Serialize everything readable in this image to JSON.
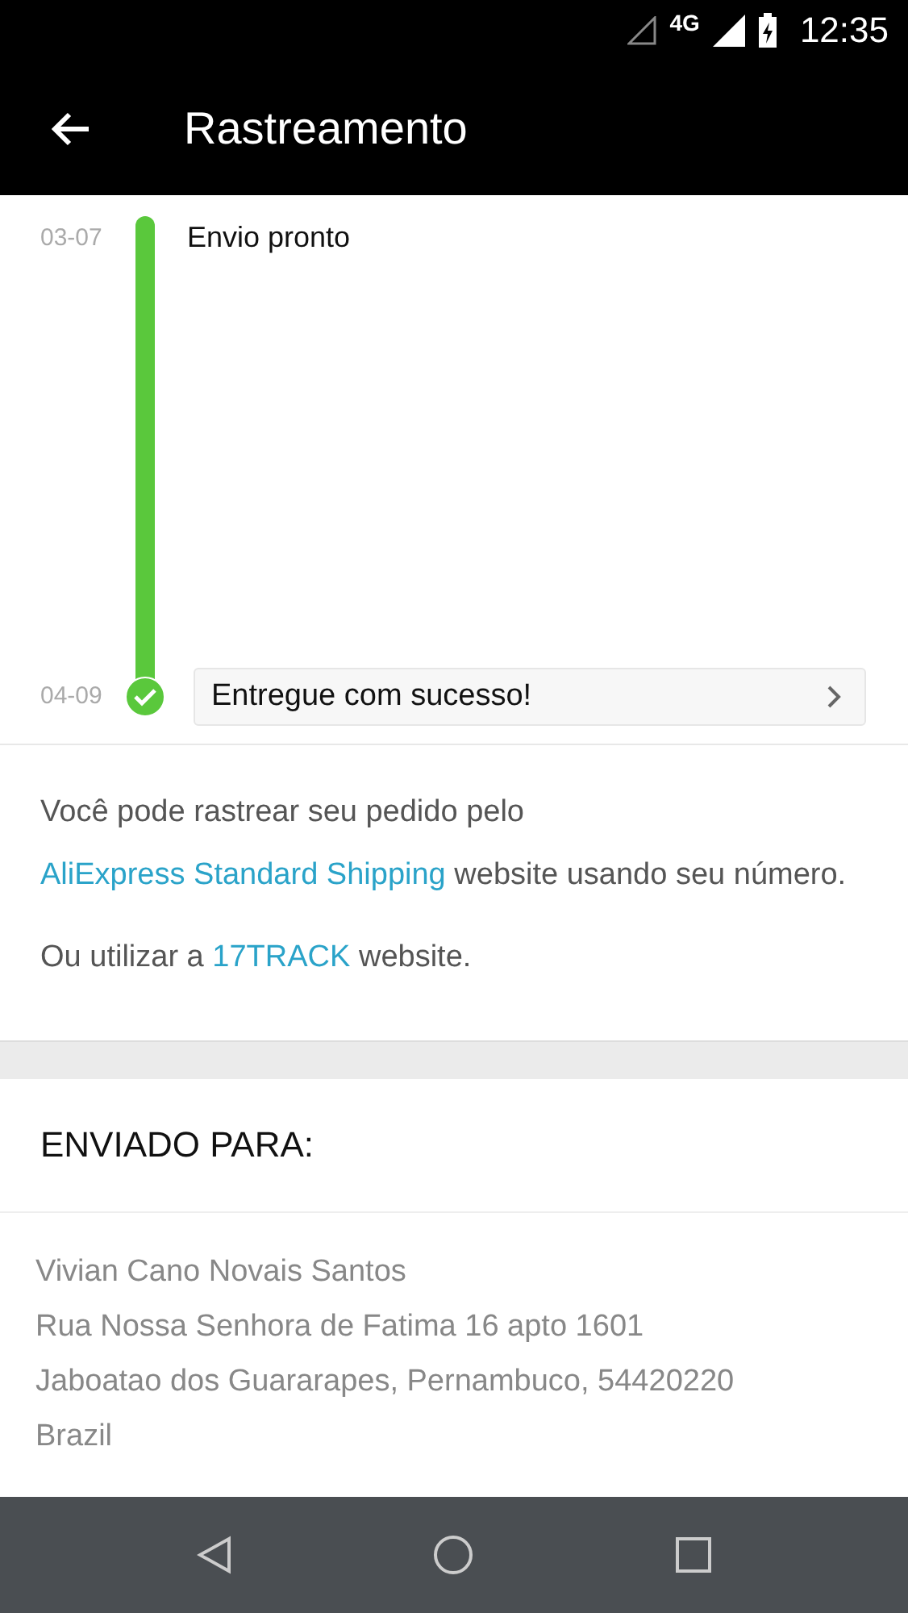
{
  "status_bar": {
    "network": "4G",
    "time": "12:35"
  },
  "app_bar": {
    "title": "Rastreamento"
  },
  "timeline": [
    {
      "date": "03-07",
      "label": "Envio pronto",
      "kind": "plain"
    },
    {
      "date": "04-09",
      "label": "Entregue com sucesso!",
      "kind": "card"
    }
  ],
  "info": [
    [
      {
        "text": "Você pode rastrear seu pedido pelo "
      },
      {
        "text": "AliExpress Standard Shipping",
        "link": true
      },
      {
        "text": " website usando seu número."
      }
    ],
    [
      {
        "text": "Ou utilizar a "
      },
      {
        "text": "17TRACK",
        "link": true
      },
      {
        "text": " website."
      }
    ]
  ],
  "shipping": {
    "heading": "ENVIADO PARA:",
    "address": [
      "Vivian Cano Novais Santos",
      "Rua Nossa Senhora de Fatima 16 apto 1601",
      "Jaboatao dos Guararapes, Pernambuco, 54420220",
      "Brazil"
    ]
  }
}
